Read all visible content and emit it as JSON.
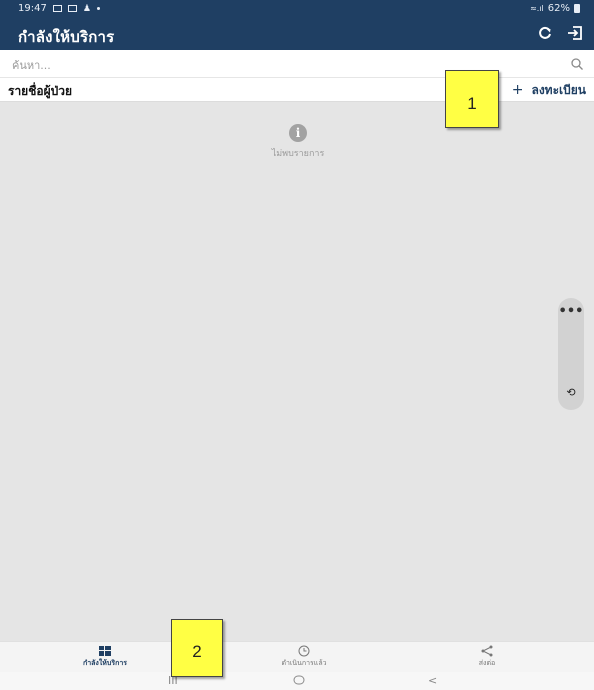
{
  "status_bar": {
    "time": "19:47",
    "battery": "62%"
  },
  "app_bar": {
    "title": "กำลังให้บริการ",
    "refresh_icon": "refresh-icon",
    "logout_icon": "logout-icon"
  },
  "search": {
    "placeholder": "ค้นหา..."
  },
  "list_header": {
    "label": "รายชื่อผู้ป่วย",
    "register_plus": "+",
    "register_label": "ลงทะเบียน"
  },
  "empty_state": {
    "icon": "info-icon",
    "message": "ไม่พบรายการ"
  },
  "side_panel": {
    "more_label": "•••"
  },
  "callouts": {
    "one": "1",
    "two": "2"
  },
  "bottom_nav": {
    "tabs": [
      {
        "label": "กำลังให้บริการ",
        "icon": "grid-icon",
        "active": true
      },
      {
        "label": "ดำเนินการแล้ว",
        "icon": "clock-icon",
        "active": false
      },
      {
        "label": "ส่งต่อ",
        "icon": "share-icon",
        "active": false
      }
    ]
  },
  "system_nav": {
    "recents": "III",
    "back": "<"
  },
  "colors": {
    "primary": "#1f3f63",
    "content_bg": "#e5e5e5",
    "callout": "#ffff44"
  }
}
